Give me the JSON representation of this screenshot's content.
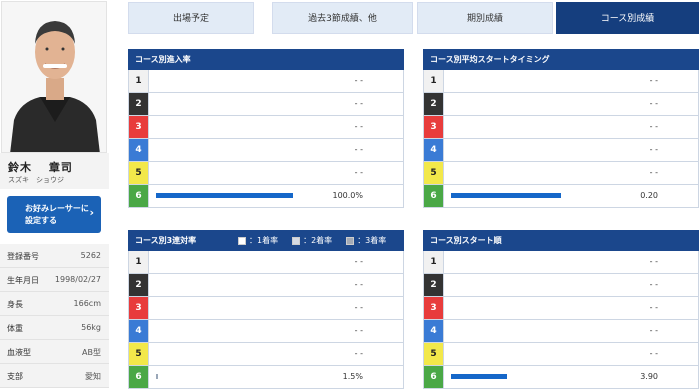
{
  "racer": {
    "name": "鈴木　 章司",
    "kana": "スズキ　ショウジ",
    "favorite_button": "お好みレーサーに\n設定する",
    "info": [
      {
        "label": "登録番号",
        "value": "5262"
      },
      {
        "label": "生年月日",
        "value": "1998/02/27"
      },
      {
        "label": "身長",
        "value": "166cm"
      },
      {
        "label": "体重",
        "value": "56kg"
      },
      {
        "label": "血液型",
        "value": "AB型"
      },
      {
        "label": "支部",
        "value": "愛知"
      }
    ]
  },
  "tabs": [
    {
      "label": "出場予定",
      "active": false
    },
    {
      "label": "過去3節成績、他",
      "active": false
    },
    {
      "label": "期別成績",
      "active": false
    },
    {
      "label": "コース別成績",
      "active": true
    }
  ],
  "lane_colors": [
    "#f1f1f1",
    "#333333",
    "#e83c3c",
    "#3a7bd5",
    "#f2e84a",
    "#4aa846"
  ],
  "lane_text_colors": [
    "#222222",
    "#ffffff",
    "#ffffff",
    "#ffffff",
    "#222222",
    "#ffffff"
  ],
  "legend": [
    {
      "label": "：1着率",
      "color": "#ffffff"
    },
    {
      "label": "：2着率",
      "color": "#d5dae3"
    },
    {
      "label": "：3着率",
      "color": "#a3aab6"
    }
  ],
  "panels": [
    {
      "title": "コース別進入率",
      "rows": [
        {
          "lane": "1",
          "value": "- -",
          "bar_fraction": 0
        },
        {
          "lane": "2",
          "value": "- -",
          "bar_fraction": 0
        },
        {
          "lane": "3",
          "value": "- -",
          "bar_fraction": 0
        },
        {
          "lane": "4",
          "value": "- -",
          "bar_fraction": 0
        },
        {
          "lane": "5",
          "value": "- -",
          "bar_fraction": 0
        },
        {
          "lane": "6",
          "value": "100.0%",
          "bar_fraction": 1.0
        }
      ]
    },
    {
      "title": "コース別平均スタートタイミング",
      "rows": [
        {
          "lane": "1",
          "value": "- -",
          "bar_fraction": 0
        },
        {
          "lane": "2",
          "value": "- -",
          "bar_fraction": 0
        },
        {
          "lane": "3",
          "value": "- -",
          "bar_fraction": 0
        },
        {
          "lane": "4",
          "value": "- -",
          "bar_fraction": 0
        },
        {
          "lane": "5",
          "value": "- -",
          "bar_fraction": 0
        },
        {
          "lane": "6",
          "value": "0.20",
          "bar_fraction": 0.8
        }
      ]
    },
    {
      "title": "コース別3連対率",
      "rows": [
        {
          "lane": "1",
          "value": "- -",
          "bar_fraction": 0
        },
        {
          "lane": "2",
          "value": "- -",
          "bar_fraction": 0
        },
        {
          "lane": "3",
          "value": "- -",
          "bar_fraction": 0
        },
        {
          "lane": "4",
          "value": "- -",
          "bar_fraction": 0
        },
        {
          "lane": "5",
          "value": "- -",
          "bar_fraction": 0
        },
        {
          "lane": "6",
          "value": "1.5%",
          "bar_fraction": 0.015
        }
      ]
    },
    {
      "title": "コース別スタート順",
      "rows": [
        {
          "lane": "1",
          "value": "- -",
          "bar_fraction": 0
        },
        {
          "lane": "2",
          "value": "- -",
          "bar_fraction": 0
        },
        {
          "lane": "3",
          "value": "- -",
          "bar_fraction": 0
        },
        {
          "lane": "4",
          "value": "- -",
          "bar_fraction": 0
        },
        {
          "lane": "5",
          "value": "- -",
          "bar_fraction": 0
        },
        {
          "lane": "6",
          "value": "3.90",
          "bar_fraction": 0.41
        }
      ]
    }
  ]
}
